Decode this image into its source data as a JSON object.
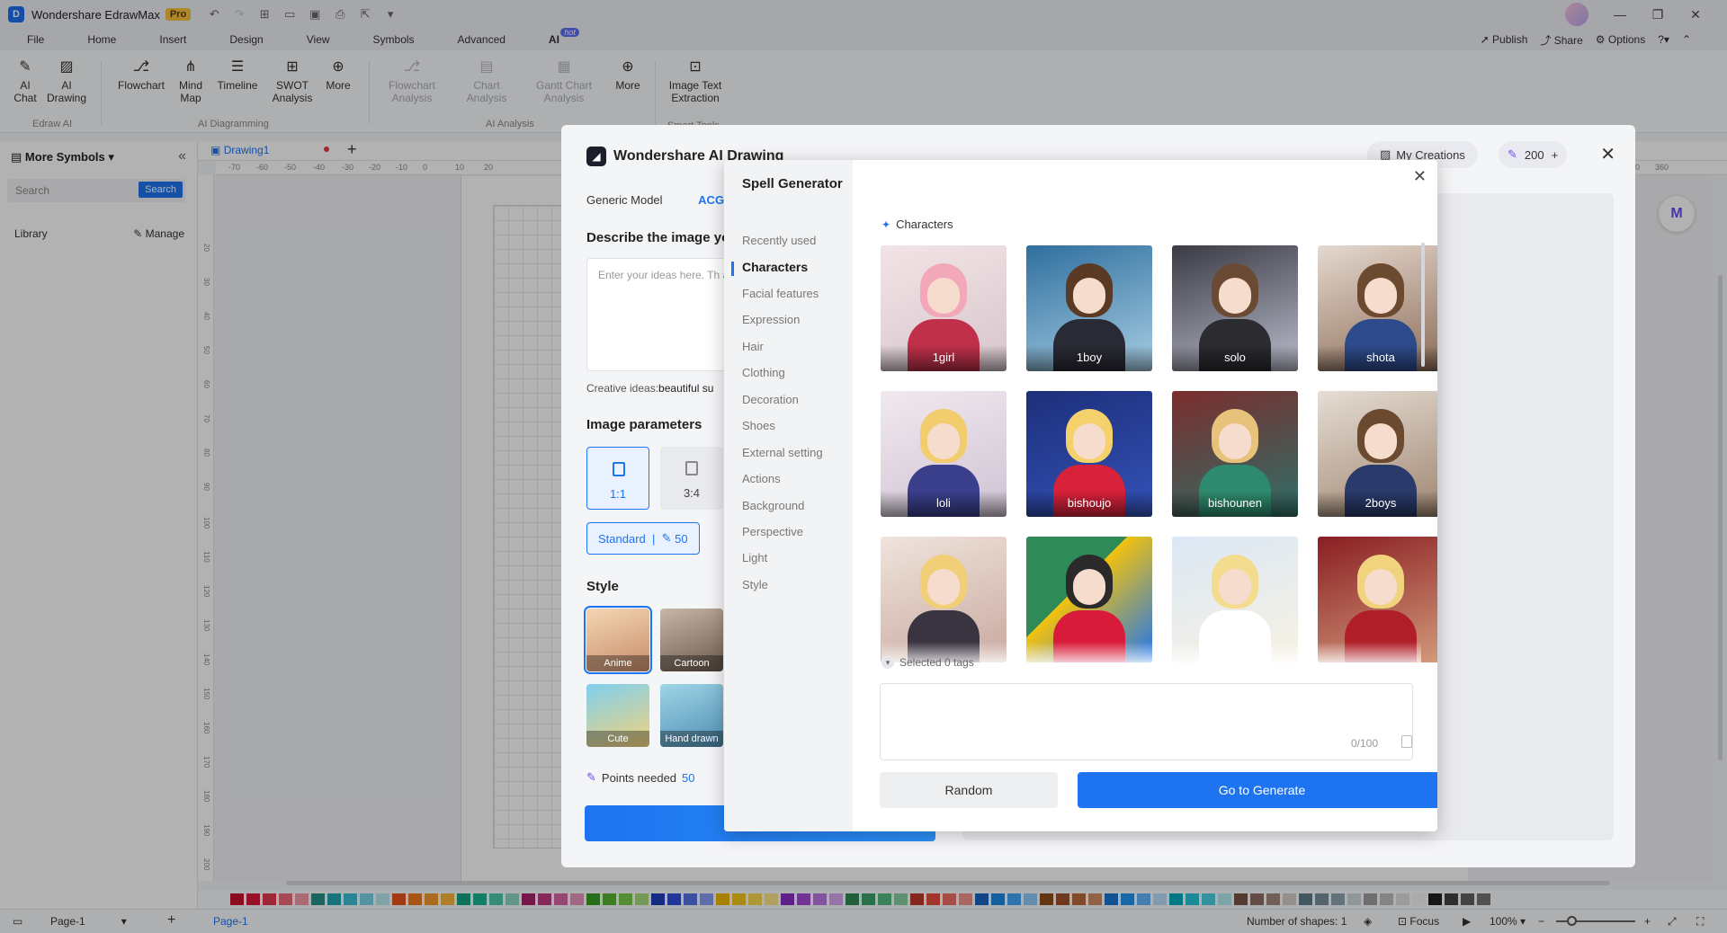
{
  "app": {
    "name": "Wondershare EdrawMax",
    "badge": "Pro"
  },
  "menu": {
    "items": [
      "File",
      "Home",
      "Insert",
      "Design",
      "View",
      "Symbols",
      "Advanced",
      "AI"
    ],
    "ai_badge": "hot",
    "right": {
      "publish": "Publish",
      "share": "Share",
      "options": "Options"
    }
  },
  "ribbon": {
    "ai_chat": "AI Chat",
    "ai_drawing": "AI Drawing",
    "group_edraw_ai": "Edraw AI",
    "flowchart": "Flowchart",
    "mind_map": "Mind Map",
    "timeline": "Timeline",
    "swot": "SWOT Analysis",
    "more1": "More",
    "group_ai_diagramming": "AI Diagramming",
    "flowchart_analysis": "Flowchart Analysis",
    "chart_analysis": "Chart Analysis",
    "gantt_analysis": "Gantt Chart Analysis",
    "more2": "More",
    "group_ai_analysis": "AI Analysis",
    "image_text": "Image Text Extraction",
    "group_smart_tools": "Smart Tools"
  },
  "left_panel": {
    "title": "More Symbols",
    "search_placeholder": "Search",
    "search_button": "Search",
    "library": "Library",
    "manage": "Manage"
  },
  "document": {
    "tab": "Drawing1"
  },
  "ruler": {
    "h": [
      "-70",
      "-60",
      "-50",
      "-40",
      "-30",
      "-20",
      "-10",
      "0",
      "10",
      "20",
      "350",
      "360"
    ],
    "v": [
      "20",
      "30",
      "40",
      "50",
      "60",
      "70",
      "80",
      "90",
      "100",
      "110",
      "120",
      "130",
      "140",
      "150",
      "160",
      "170",
      "180",
      "190",
      "200"
    ]
  },
  "ai_drawing": {
    "title": "Wondershare AI Drawing",
    "my_creations": "My Creations",
    "points": "200",
    "tabs": [
      "Generic Model",
      "ACG"
    ],
    "describe_title": "Describe the image yo",
    "describe_placeholder": "Enter your ideas here. Th accurate the result.",
    "creative_prefix": "Creative ideas:",
    "creative_value": "beautiful su",
    "image_params_title": "Image parameters",
    "ratios": [
      "1:1",
      "3:4"
    ],
    "quality_label": "Standard",
    "quality_points": "50",
    "style_title": "Style",
    "styles": [
      "Anime",
      "Cartoon",
      "Cute",
      "Hand drawn"
    ],
    "points_needed_label": "Points needed",
    "points_needed_value": "50"
  },
  "spell": {
    "title": "Spell Generator",
    "categories": [
      "Recently used",
      "Characters",
      "Facial features",
      "Expression",
      "Hair",
      "Clothing",
      "Decoration",
      "Shoes",
      "External setting",
      "Actions",
      "Background",
      "Perspective",
      "Light",
      "Style"
    ],
    "active_category": "Characters",
    "section_title": "Characters",
    "cards": [
      "1girl",
      "1boy",
      "solo",
      "shota",
      "loli",
      "bishoujo",
      "bishounen",
      "2boys",
      "",
      "",
      "",
      ""
    ],
    "selected_text": "Selected 0 tags",
    "counter": "0/100",
    "random": "Random",
    "generate": "Go to Generate"
  },
  "status": {
    "page_selector": "Page-1",
    "page_tab": "Page-1",
    "shapes": "Number of shapes: 1",
    "focus": "Focus",
    "zoom": "100%"
  },
  "colors": {
    "accent": "#1e74f0"
  }
}
